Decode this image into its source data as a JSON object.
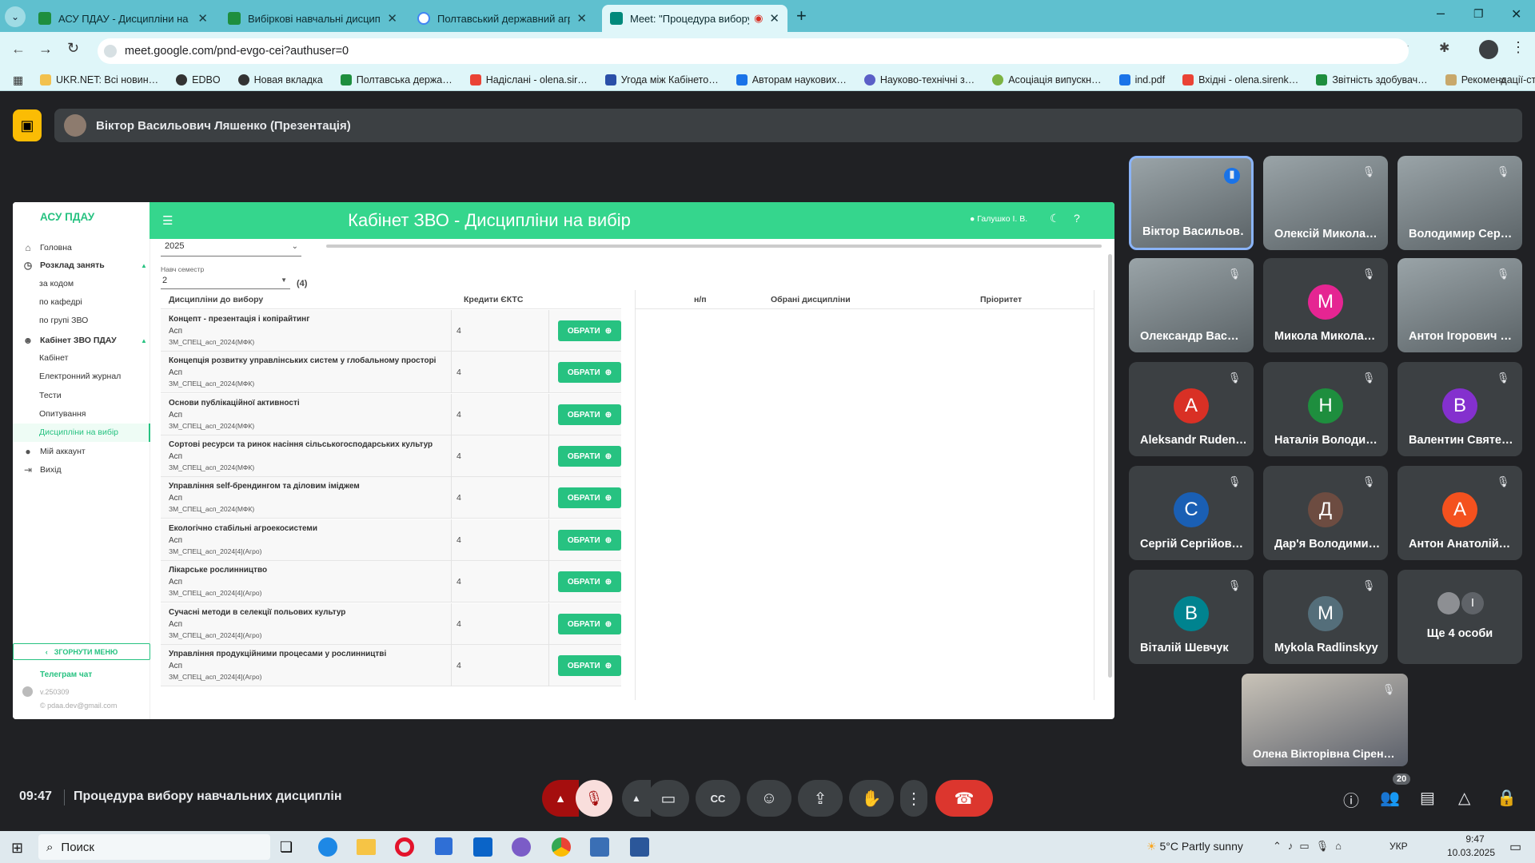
{
  "browser": {
    "tabs": [
      {
        "title": "АСУ ПДАУ - Дисципліни на ви…",
        "color": "#1e8e3e"
      },
      {
        "title": "Вибіркові навчальні дисциплі…",
        "color": "#1e8e3e"
      },
      {
        "title": "Полтавський державний агра…",
        "color": "#4285f4"
      },
      {
        "title": "Meet: \"Процедура вибору…",
        "color": "#00897b"
      }
    ],
    "url": "meet.google.com/pnd-evgo-cei?authuser=0",
    "bookmarks": [
      "UKR.NET: Всі новин…",
      "EDBO",
      "Новая вкладка",
      "Полтавська держа…",
      "Надіслані - olena.sir…",
      "Угода між Кабінето…",
      "Авторам наукових…",
      "Науково-технічні з…",
      "Асоціація випускн…",
      "ind.pdf",
      "Вхідні - olena.sirenk…",
      "Звітність здобувач…",
      "Рекомендації-стос…"
    ]
  },
  "meet": {
    "presenter_label": "Віктор Васильович Ляшенко (Презентація)",
    "clock": "09:47",
    "meeting_title": "Процедура вибору навчальних дисциплін",
    "participant_count": "20",
    "participants": [
      {
        "name": "Віктор Васильов…",
        "type": "camera",
        "speaking": true
      },
      {
        "name": "Олексій Микола…",
        "type": "camera"
      },
      {
        "name": "Володимир Сер…",
        "type": "camera"
      },
      {
        "name": "Олександр Вас…",
        "type": "camera"
      },
      {
        "name": "Микола Микола…",
        "type": "avatar",
        "letter": "M",
        "color": "#e52592"
      },
      {
        "name": "Антон Ігорович …",
        "type": "camera"
      },
      {
        "name": "Aleksandr Ruden…",
        "type": "avatar",
        "letter": "A",
        "color": "#d93025"
      },
      {
        "name": "Наталія Володи…",
        "type": "avatar",
        "letter": "Н",
        "color": "#1e8e3e"
      },
      {
        "name": "Валентин Святе…",
        "type": "avatar",
        "letter": "В",
        "color": "#8430ce"
      },
      {
        "name": "Сергій Сергійов…",
        "type": "avatar",
        "letter": "С",
        "color": "#1a5fb4"
      },
      {
        "name": "Дар'я Володими…",
        "type": "avatar",
        "letter": "Д",
        "color": "#6d4c41"
      },
      {
        "name": "Антон Анатолій…",
        "type": "avatar",
        "letter": "А",
        "color": "#f4511e"
      },
      {
        "name": "Віталій Шевчук",
        "type": "avatar",
        "letter": "В",
        "color": "#00838f"
      },
      {
        "name": "Mykola Radlinskyy",
        "type": "avatar",
        "letter": "M",
        "color": "#546e7a"
      },
      {
        "name": "Ще 4 особи",
        "type": "more",
        "letter": "I"
      }
    ],
    "self_name": "Олена Вікторівна Сірен…"
  },
  "app": {
    "brand": "АСУ ПДАУ",
    "header_title": "Кабінет ЗВО - Дисципліни на вибір",
    "user": "Галушко І. В.",
    "year_value": "2025",
    "semester_label": "Навч семестр",
    "semester_value": "2",
    "count": "(4)",
    "nav": {
      "home": "Головна",
      "schedule": "Розклад занять",
      "by_code": "за кодом",
      "by_dept": "по кафедрі",
      "by_group": "по групі ЗВО",
      "cabinet": "Кабінет ЗВО ПДАУ",
      "cabinet_sub": "Кабінет",
      "journal": "Електронний журнал",
      "tests": "Тести",
      "surveys": "Опитування",
      "electives": "Дисципліни на вибір",
      "account": "Мій аккаунт",
      "exit": "Вихід",
      "collapse": "ЗГОРНУТИ МЕНЮ",
      "telegram": "Телеграм чат",
      "version": "v.250309",
      "email": "© pdaa.dev@gmail.com"
    },
    "table": {
      "col_discipline": "Дисципліни до вибору",
      "col_credits": "Кредити ЄКТС",
      "col_num": "н/п",
      "col_selected": "Обрані дисципліни",
      "col_priority": "Пріоритет",
      "button_label": "ОБРАТИ",
      "rows": [
        {
          "name": "Концепт - презентація і копірайтинг",
          "level": "Асп",
          "code": "ЗМ_СПЕЦ_асп_2024(МФК)",
          "credits": "4"
        },
        {
          "name": "Концепція розвитку управлінських систем у глобальному просторі",
          "level": "Асп",
          "code": "ЗМ_СПЕЦ_асп_2024(МФК)",
          "credits": "4"
        },
        {
          "name": "Основи публікаційної активності",
          "level": "Асп",
          "code": "ЗМ_СПЕЦ_асп_2024(МФК)",
          "credits": "4"
        },
        {
          "name": "Сортові ресурси та ринок насіння сільськогосподарських культур",
          "level": "Асп",
          "code": "ЗМ_СПЕЦ_асп_2024(МФК)",
          "credits": "4"
        },
        {
          "name": "Управління self-брендингом та діловим іміджем",
          "level": "Асп",
          "code": "ЗМ_СПЕЦ_асп_2024(МФК)",
          "credits": "4"
        },
        {
          "name": "Екологічно стабільні агроекосистеми",
          "level": "Асп",
          "code": "ЗМ_СПЕЦ_асп_2024[4](Агро)",
          "credits": "4"
        },
        {
          "name": "Лікарське рослинництво",
          "level": "Асп",
          "code": "ЗМ_СПЕЦ_асп_2024[4](Агро)",
          "credits": "4"
        },
        {
          "name": "Сучасні методи в селекції польових культур",
          "level": "Асп",
          "code": "ЗМ_СПЕЦ_асп_2024[4](Агро)",
          "credits": "4"
        },
        {
          "name": "Управління продукційними процесами у рослинництві",
          "level": "Асп",
          "code": "ЗМ_СПЕЦ_асп_2024[4](Агро)",
          "credits": "4"
        }
      ]
    }
  },
  "taskbar": {
    "search": "Поиск",
    "weather": "5°C  Partly sunny",
    "lang": "УКР",
    "time": "9:47",
    "date": "10.03.2025"
  }
}
